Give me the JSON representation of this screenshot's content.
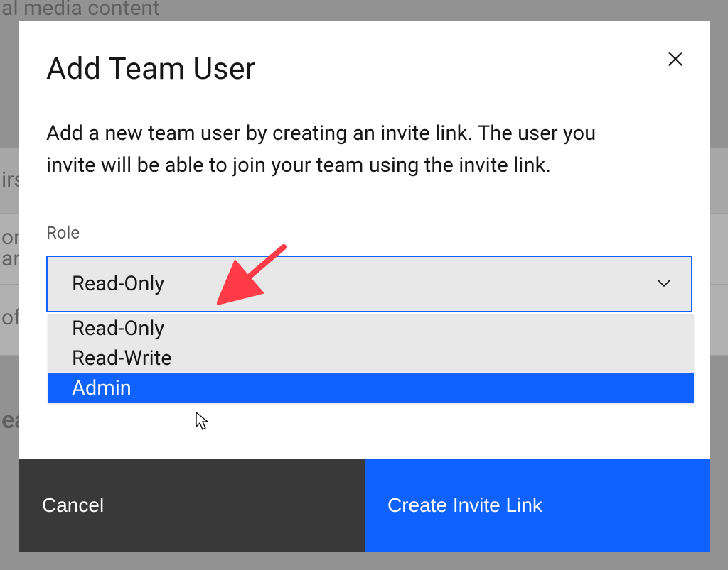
{
  "background": {
    "top_fragment": "al media content",
    "row1": "irs",
    "row2a": "on",
    "row2b": "ar",
    "row3": "of",
    "row4": "ea"
  },
  "modal": {
    "title": "Add Team User",
    "description": "Add a new team user by creating an invite link. The user you invite will be able to join your team using the invite link.",
    "role_label": "Role",
    "selected_role": "Read-Only",
    "options": [
      "Read-Only",
      "Read-Write",
      "Admin"
    ],
    "highlighted_index": 2,
    "cancel_label": "Cancel",
    "create_label": "Create Invite Link"
  },
  "annotation": {
    "arrow_color": "#ff3b47"
  }
}
